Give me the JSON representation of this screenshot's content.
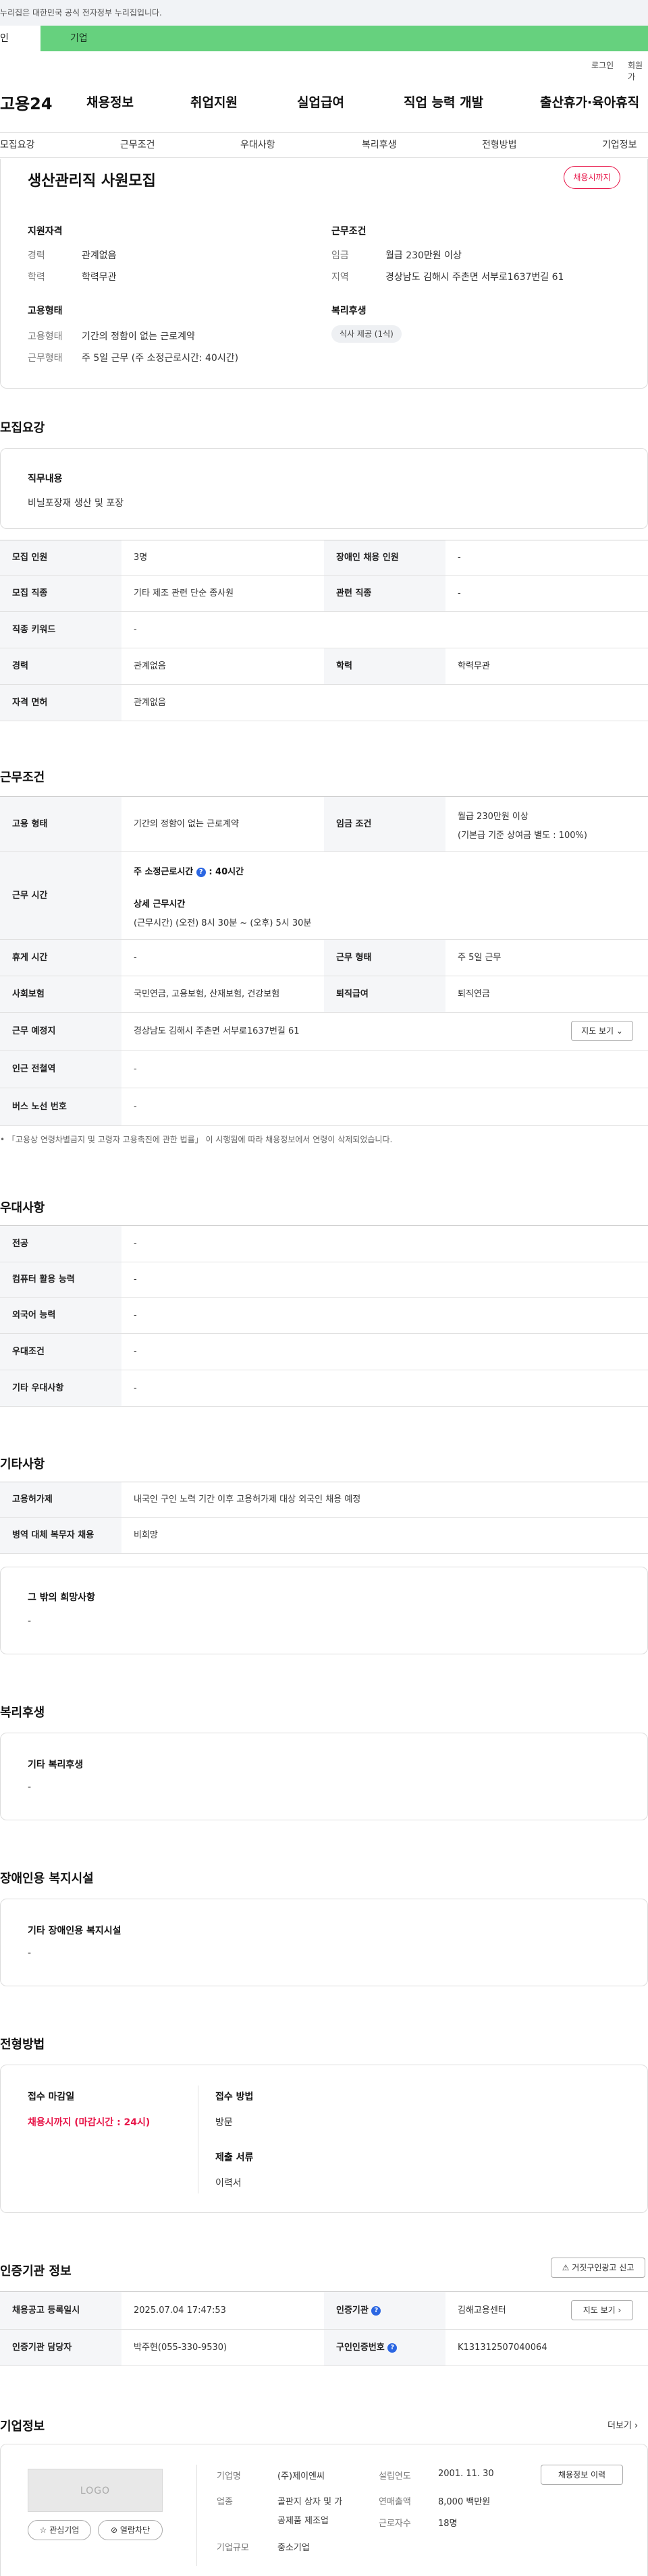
{
  "gov_banner": "누리집은 대한민국 공식 전자정부 누리집입니다.",
  "site_tabs": {
    "individual": "인",
    "company": "기업"
  },
  "util": {
    "login": "로그인",
    "join": "회원가"
  },
  "logo": "고용24",
  "gnb": [
    "채용정보",
    "취업지원",
    "실업급여",
    "직업 능력 개발",
    "출산휴가·육아휴직"
  ],
  "anchor_nav": [
    "모집요강",
    "근무조건",
    "우대사항",
    "복리후생",
    "전형방법",
    "기업정보"
  ],
  "summary": {
    "title": "생산관리직 사원모집",
    "badge": "채용시까지",
    "qual_title": "지원자격",
    "qual_rows": [
      [
        "경력",
        "관계없음"
      ],
      [
        "학력",
        "학력무관"
      ]
    ],
    "work_title": "근무조건",
    "work_rows": [
      [
        "임금",
        "월급 230만원 이상"
      ],
      [
        "지역",
        "경상남도 김해시 주촌면 서부로1637번길 61"
      ]
    ],
    "emp_title": "고용형태",
    "emp_rows": [
      [
        "고용형태",
        "기간의 정함이 없는 근로계약"
      ],
      [
        "근무형태",
        "주 5일 근무 (주 소정근로시간: 40시간)"
      ]
    ],
    "welfare_title": "복리후생",
    "welfare_chip": "식사 제공 (1식)"
  },
  "recruit": {
    "heading": "모집요강",
    "duty_label": "직무내용",
    "duty_value": "비닐포장재 생산 및 포장",
    "rows": [
      [
        "모집 인원",
        "3명",
        "장애인 채용 인원",
        "-"
      ],
      [
        "모집 직종",
        "기타 제조 관련 단순 종사원",
        "관련 직종",
        "-"
      ],
      [
        "직종 키워드",
        "-"
      ],
      [
        "경력",
        "관계없음",
        "학력",
        "학력무관"
      ],
      [
        "자격 면허",
        "관계없음"
      ]
    ]
  },
  "conditions": {
    "heading": "근무조건",
    "emp_type_label": "고용 형태",
    "emp_type": "기간의 정함이 없는 근로계약",
    "wage_label": "임금 조건",
    "wage_1": "월급 230만원 이상",
    "wage_2": "(기본급 기준 상여금 별도 : 100%)",
    "hours_label": "근무 시간",
    "hours_total": "주 소정근로시간",
    "hours_total_value": ": 40시간",
    "hours_detail_title": "상세 근무시간",
    "hours_detail": "(근무시간) (오전) 8시 30분 ~ (오후) 5시 30분",
    "break_label": "휴게 시간",
    "break_value": "-",
    "shift_label": "근무 형태",
    "shift_value": "주 5일 근무",
    "insurance_label": "사회보험",
    "insurance_value": "국민연금, 고용보험, 산재보험, 건강보험",
    "retire_label": "퇴직급여",
    "retire_value": "퇴직연금",
    "place_label": "근무 예정지",
    "place_value": "경상남도 김해시 주촌면 서부로1637번길 61",
    "map_btn": "지도 보기",
    "subway_label": "인근 전철역",
    "subway_value": "-",
    "bus_label": "버스 노선 번호",
    "bus_value": "-",
    "notice": "「고용상 연령차별금지 및 고령자 고용촉진에 관한 법률」 이 시행됨에 따라 채용정보에서 연령이 삭제되었습니다."
  },
  "prefer": {
    "heading": "우대사항",
    "rows": [
      [
        "전공",
        "-"
      ],
      [
        "컴퓨터 활용 능력",
        "-"
      ],
      [
        "외국어 능력",
        "-"
      ],
      [
        "우대조건",
        "-"
      ],
      [
        "기타 우대사항",
        "-"
      ]
    ]
  },
  "other": {
    "heading": "기타사항",
    "rows": [
      [
        "고용허가제",
        "내국인 구인 노력 기간 이후 고용허가제 대상 외국인 채용 예정"
      ],
      [
        "병역 대체 복무자 채용",
        "비희망"
      ]
    ],
    "box_title": "그 밖의 희망사항",
    "box_value": "-"
  },
  "welfare": {
    "heading": "복리후생",
    "box_title": "기타 복리후생",
    "box_value": "-"
  },
  "disability": {
    "heading": "장애인용 복지시설",
    "box_title": "기타 장애인용 복지시설",
    "box_value": "-"
  },
  "screening": {
    "heading": "전형방법",
    "deadline_label": "접수 마감일",
    "deadline_value": "채용시까지 (마감시간 : 24시)",
    "method_label": "접수 방법",
    "method_value": "방문",
    "docs_label": "제출 서류",
    "docs_value": "이력서"
  },
  "auth": {
    "heading": "인증기관 정보",
    "report_btn": "거짓구인광고 신고",
    "reg_date_label": "채용공고 등록일시",
    "reg_date": "2025.07.04 17:47:53",
    "agency_label": "인증기관",
    "agency": "김해고용센터",
    "map_btn": "지도 보기",
    "manager_label": "인증기관 담당자",
    "manager": "박주현(055-330-9530)",
    "reg_no_label": "구인인증번호",
    "reg_no": "K131312507040064"
  },
  "company": {
    "heading": "기업정보",
    "more": "더보기",
    "logo_text": "LOGO",
    "fav_btn": "관심기업",
    "block_btn": "열람차단",
    "name_label": "기업명",
    "name": "(주)제이엔씨",
    "industry_label": "업종",
    "industry_1": "골판지 상자 및 가",
    "industry_2": "공제품 제조업",
    "size_label": "기업규모",
    "size": "중소기업",
    "founded_label": "설립연도",
    "founded": "2001. 11. 30",
    "sales_label": "연매출액",
    "sales": "8,000 백만원",
    "staff_label": "근로자수",
    "staff": "18명",
    "history_btn": "채용정보 이력"
  }
}
